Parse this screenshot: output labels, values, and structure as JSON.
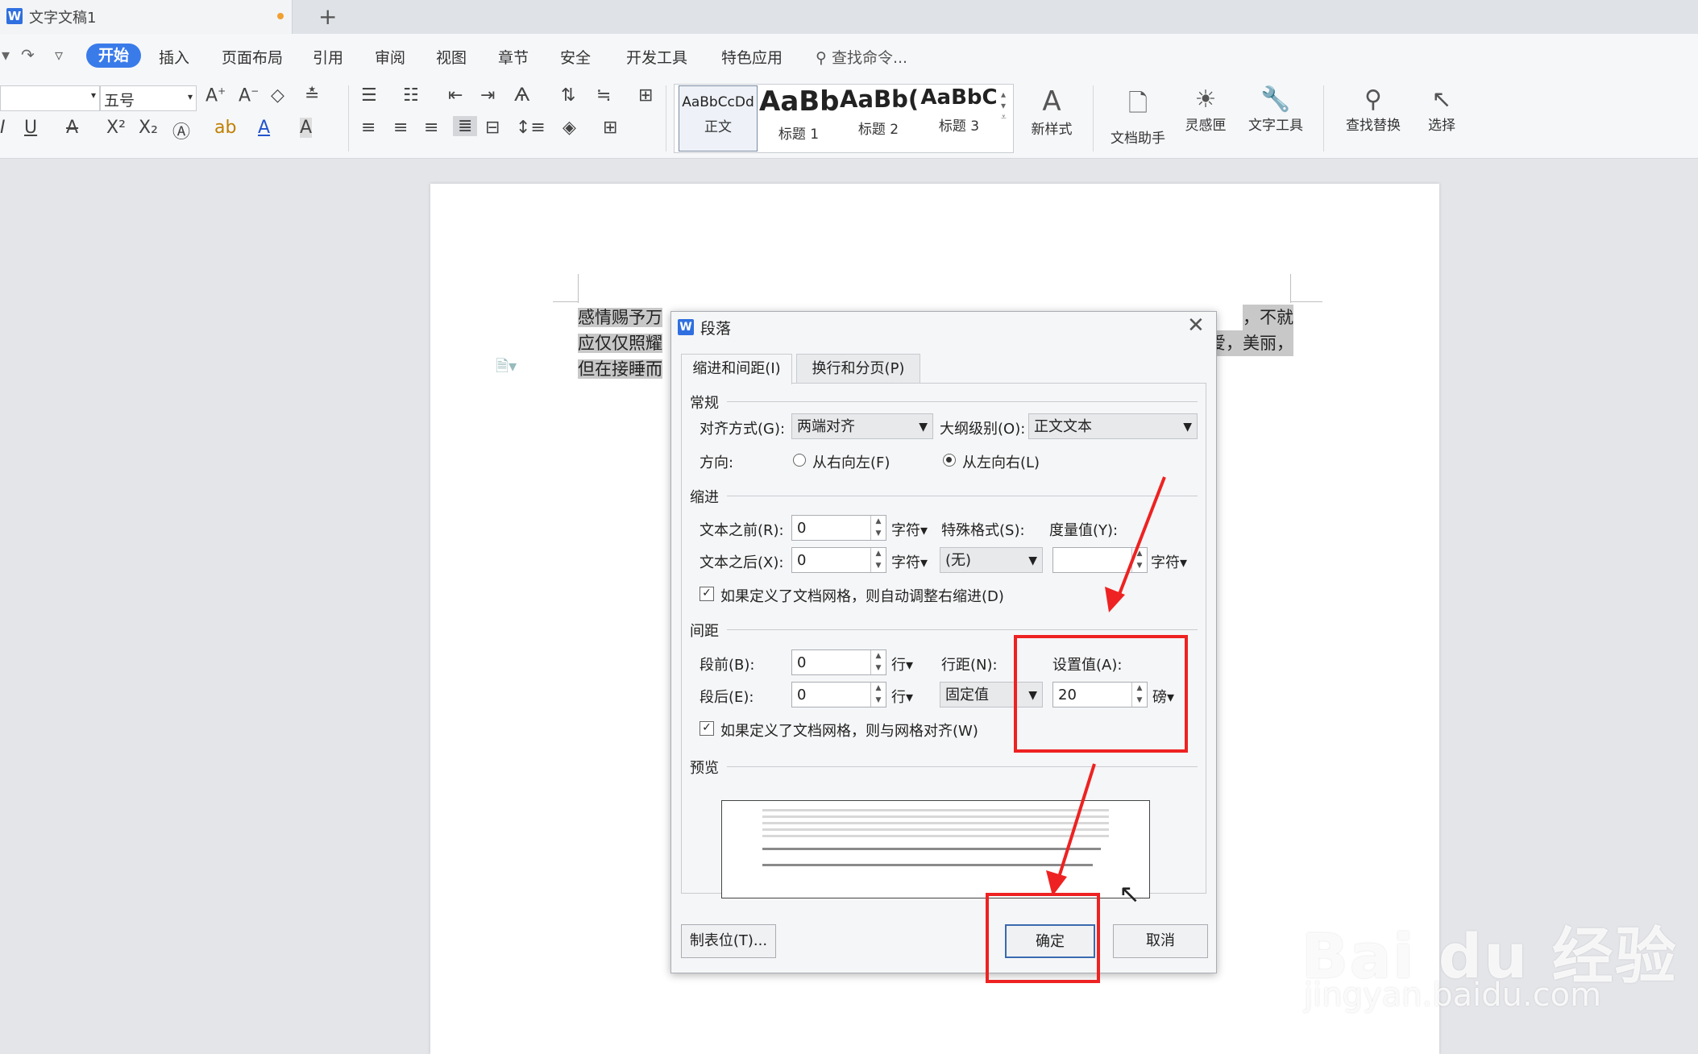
{
  "window": {
    "tab_title": "文字文稿1",
    "new_tab": "+"
  },
  "menubar": {
    "quick": [
      "↶",
      "↷",
      "▿"
    ],
    "items": [
      "开始",
      "插入",
      "页面布局",
      "引用",
      "审阅",
      "视图",
      "章节",
      "安全",
      "开发工具",
      "特色应用"
    ],
    "search": "查找命令..."
  },
  "ribbon": {
    "font_size": "五号",
    "styles": [
      {
        "sample": "AaBbCcDd",
        "label": "正文"
      },
      {
        "sample": "AaBb",
        "label": "标题 1"
      },
      {
        "sample": "AaBb(",
        "label": "标题 2"
      },
      {
        "sample": "AaBbC",
        "label": "标题 3"
      }
    ],
    "new_style": "新样式",
    "tools": [
      {
        "icon": "document-assistant-icon",
        "label": "文档助手"
      },
      {
        "icon": "lightbulb-icon",
        "label": "灵感匣"
      },
      {
        "icon": "wrench-icon",
        "label": "文字工具"
      },
      {
        "icon": "magnifier-icon",
        "label": "查找替换"
      },
      {
        "icon": "cursor-icon",
        "label": "选择"
      }
    ]
  },
  "document": {
    "lines": [
      "感情赐予万",
      "，不就",
      "应仅仅照耀",
      "爱，美丽，",
      "但在接睡而"
    ]
  },
  "dialog": {
    "title": "段落",
    "tabs": [
      "缩进和间距(I)",
      "换行和分页(P)"
    ],
    "general": {
      "section": "常规",
      "alignment_label": "对齐方式(G):",
      "alignment_value": "两端对齐",
      "outline_label": "大纲级别(O):",
      "outline_value": "正文文本",
      "direction_label": "方向:",
      "rtl": "从右向左(F)",
      "ltr": "从左向右(L)"
    },
    "indent": {
      "section": "缩进",
      "before_label": "文本之前(R):",
      "before_value": "0",
      "after_label": "文本之后(X):",
      "after_value": "0",
      "unit": "字符",
      "special_label": "特殊格式(S):",
      "special_value": "(无)",
      "measure_label": "度量值(Y):",
      "measure_value": "",
      "auto_adjust": "如果定义了文档网格，则自动调整右缩进(D)"
    },
    "spacing": {
      "section": "间距",
      "before_label": "段前(B):",
      "before_value": "0",
      "after_label": "段后(E):",
      "after_value": "0",
      "unit": "行",
      "line_label": "行距(N):",
      "line_value": "固定值",
      "set_label": "设置值(A):",
      "set_value": "20",
      "set_unit": "磅",
      "grid_align": "如果定义了文档网格，则与网格对齐(W)"
    },
    "preview": {
      "section": "预览"
    },
    "buttons": {
      "tabs": "制表位(T)...",
      "ok": "确定",
      "cancel": "取消"
    }
  },
  "watermark": {
    "brand": "Bai du 经验",
    "url": "jingyan.baidu.com"
  },
  "colors": {
    "accent": "#3a7bea",
    "annotation": "#ee2222"
  }
}
